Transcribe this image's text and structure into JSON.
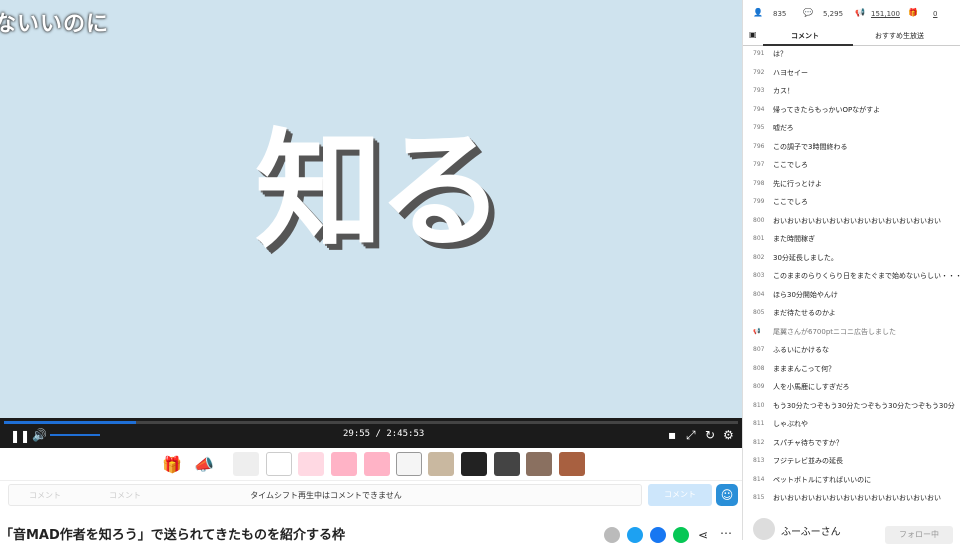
{
  "video": {
    "overlay_text": "ないいのに",
    "main_text": "知る"
  },
  "player": {
    "time": "29:55 / 2:45:53",
    "seek_progress": 0.18
  },
  "comment_input": {
    "placeholder_left": "コメント",
    "placeholder_mid": "コメント",
    "notice": "タイムシフト再生中はコメントできません",
    "submit_label": "コメント"
  },
  "program_title": "「音MAD作者を知ろう」で送られてきたものを紹介する枠",
  "stats": {
    "viewers": "835",
    "comments": "5,295",
    "ad_points": "151,100",
    "gifts": "0"
  },
  "tabs": [
    "コメント",
    "おすすめ生放送"
  ],
  "comments": [
    {
      "num": "791",
      "text": "は？"
    },
    {
      "num": "792",
      "text": "ハヨセイー"
    },
    {
      "num": "793",
      "text": "カス！"
    },
    {
      "num": "794",
      "text": "帰ってきたらもっかいOPながすよ"
    },
    {
      "num": "795",
      "text": "嘘だろ"
    },
    {
      "num": "796",
      "text": "この調子で3時間終わる"
    },
    {
      "num": "797",
      "text": "ここでしろ"
    },
    {
      "num": "798",
      "text": "先に行っとけよ"
    },
    {
      "num": "799",
      "text": "ここでしろ"
    },
    {
      "num": "800",
      "text": "おいおいおいおいおいおいおいおいおいおいおいおい"
    },
    {
      "num": "801",
      "text": "また時間稼ぎ"
    },
    {
      "num": "802",
      "text": "30分延長しました。"
    },
    {
      "num": "803",
      "text": "このままのらりくらり日をまたぐまで始めないらしい・・・"
    },
    {
      "num": "804",
      "text": "ほら30分開始やんけ"
    },
    {
      "num": "805",
      "text": "まだ待たせるのかよ"
    },
    {
      "num": "",
      "text": "尾翼さんが6700ptニコニ広告しました",
      "system": true
    },
    {
      "num": "807",
      "text": "ふるいにかけるな"
    },
    {
      "num": "808",
      "text": "まままんこって何？"
    },
    {
      "num": "809",
      "text": "人を小馬鹿にしすぎだろ"
    },
    {
      "num": "810",
      "text": "もう30分たつぞもう30分たつぞもう30分たつぞもう30分"
    },
    {
      "num": "811",
      "text": "しゃぶれや"
    },
    {
      "num": "812",
      "text": "スパチャ待ちですか？"
    },
    {
      "num": "813",
      "text": "フジテレビ並みの延長"
    },
    {
      "num": "814",
      "text": "ペットボトルにすればいいのに"
    },
    {
      "num": "815",
      "text": "おいおいおいおいおいおいおいおいおいおいおいおい"
    }
  ],
  "broadcaster": {
    "name": "ふーふーさん",
    "follow_label": "フォロー中"
  }
}
